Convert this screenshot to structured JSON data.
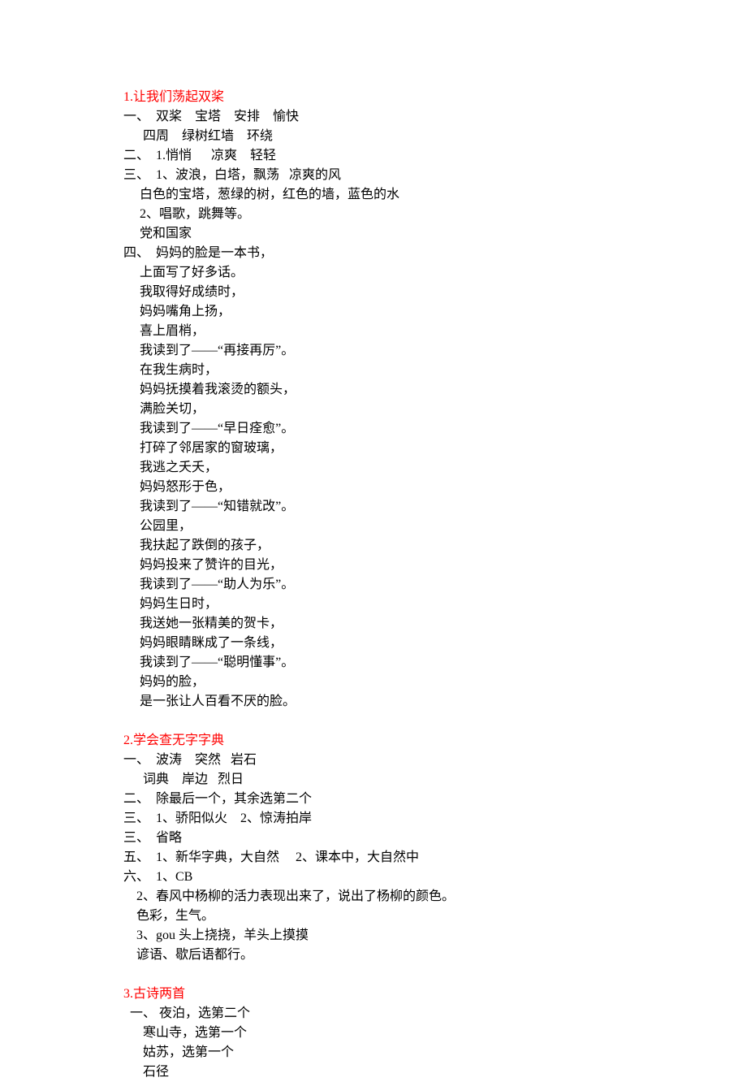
{
  "section1": {
    "title": "1.让我们荡起双桨",
    "lines": [
      "一、  双桨    宝塔    安排    愉快",
      "      四周    绿树红墙    环绕",
      "二、  1.悄悄      凉爽    轻轻",
      "三、  1、波浪，白塔，飘荡   凉爽的风",
      "     白色的宝塔，葱绿的树，红色的墙，蓝色的水",
      "     2、唱歌，跳舞等。",
      "     党和国家",
      "四、  妈妈的脸是一本书，",
      "     上面写了好多话。",
      "     我取得好成绩时，",
      "     妈妈嘴角上扬，",
      "     喜上眉梢，",
      "     我读到了——“再接再厉”。",
      "     在我生病时，",
      "     妈妈抚摸着我滚烫的额头，",
      "     满脸关切，",
      "     我读到了——“早日痊愈”。",
      "     打碎了邻居家的窗玻璃，",
      "     我逃之夭夭，",
      "     妈妈怒形于色，",
      "     我读到了——“知错就改”。",
      "     公园里，",
      "     我扶起了跌倒的孩子，",
      "     妈妈投来了赞许的目光，",
      "     我读到了——“助人为乐”。",
      "     妈妈生日时，",
      "     我送她一张精美的贺卡，",
      "     妈妈眼睛眯成了一条线，",
      "     我读到了——“聪明懂事”。",
      "     妈妈的脸，",
      "     是一张让人百看不厌的脸。"
    ]
  },
  "section2": {
    "title": "2.学会查无字字典",
    "lines": [
      "一、  波涛    突然   岩石",
      "      词典    岸边   烈日",
      "二、  除最后一个，其余选第二个",
      "三、  1、骄阳似火    2、惊涛拍岸",
      "三、  省略",
      "五、  1、新华字典，大自然     2、课本中，大自然中",
      "六、  1、CB",
      "    2、春风中杨柳的活力表现出来了，说出了杨柳的颜色。",
      "    色彩，生气。",
      "    3、gou 头上挠挠，羊头上摸摸",
      "    谚语、歇后语都行。"
    ]
  },
  "section3": {
    "title": "3.古诗两首",
    "lines": [
      "  一、 夜泊，选第二个",
      "      寒山寺，选第一个",
      "      姑苏，选第一个",
      "      石径"
    ]
  }
}
